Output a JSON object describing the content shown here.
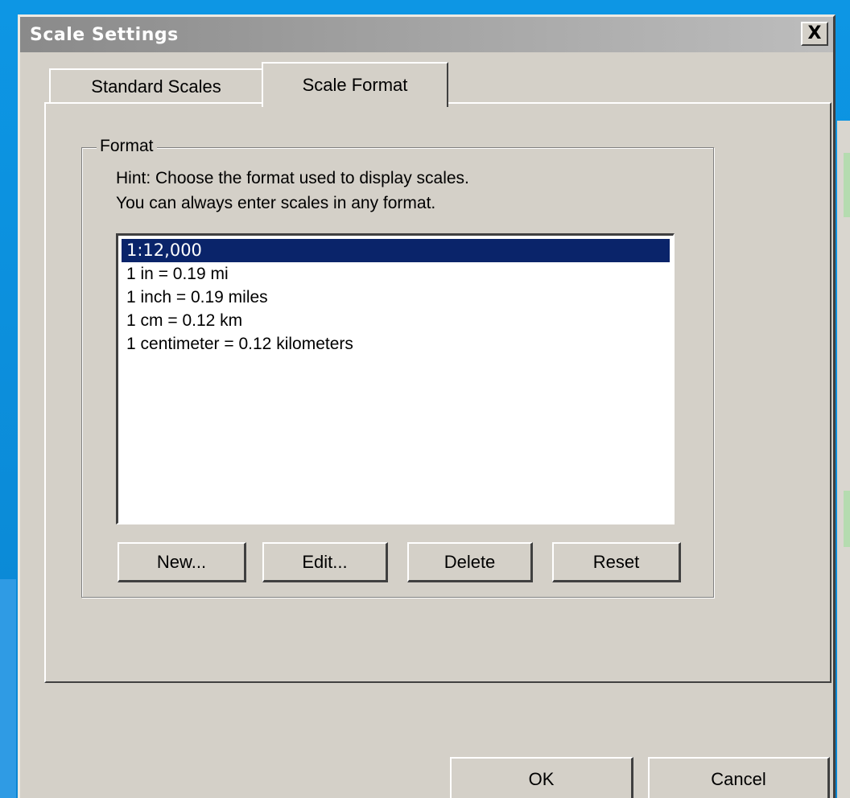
{
  "window": {
    "title": "Scale Settings",
    "close_label": "X"
  },
  "tabs": [
    {
      "label": "Standard Scales",
      "active": false
    },
    {
      "label": "Scale Format",
      "active": true
    }
  ],
  "format_group": {
    "legend": "Format",
    "hint_line1": "Hint: Choose the format used to display scales.",
    "hint_line2": "You can always enter scales in any format.",
    "list_items": [
      {
        "label": "1:12,000",
        "selected": true
      },
      {
        "label": "1 in = 0.19 mi",
        "selected": false
      },
      {
        "label": "1 inch = 0.19 miles",
        "selected": false
      },
      {
        "label": "1 cm = 0.12 km",
        "selected": false
      },
      {
        "label": "1 centimeter = 0.12 kilometers",
        "selected": false
      }
    ],
    "buttons": {
      "new_label": "New...",
      "edit_label": "Edit...",
      "delete_label": "Delete",
      "reset_label": "Reset"
    }
  },
  "footer": {
    "ok_label": "OK",
    "cancel_label": "Cancel"
  },
  "colors": {
    "selection": "#0a246a",
    "dialog_face": "#d4d0c8",
    "titlebar_inactive": "#8a8a8a",
    "desktop": "#0b8ad6"
  }
}
